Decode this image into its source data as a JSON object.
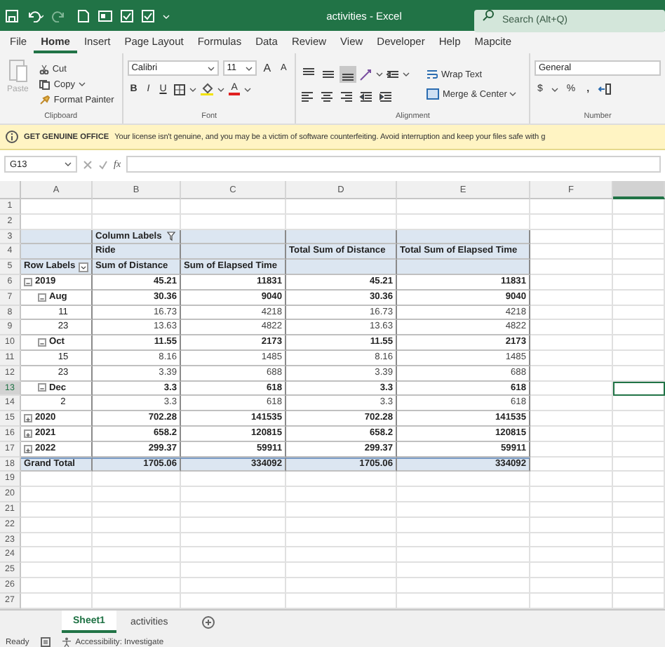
{
  "title_bar": {
    "title": "activities - Excel",
    "search": {
      "placeholder": "Search (Alt+Q)"
    }
  },
  "ribbon_tabs": [
    {
      "label": "File",
      "selected": false
    },
    {
      "label": "Home",
      "selected": true
    },
    {
      "label": "Insert",
      "selected": false
    },
    {
      "label": "Page Layout",
      "selected": false
    },
    {
      "label": "Formulas",
      "selected": false
    },
    {
      "label": "Data",
      "selected": false
    },
    {
      "label": "Review",
      "selected": false
    },
    {
      "label": "View",
      "selected": false
    },
    {
      "label": "Developer",
      "selected": false
    },
    {
      "label": "Help",
      "selected": false
    },
    {
      "label": "Mapcite",
      "selected": false
    }
  ],
  "ribbon": {
    "clipboard": {
      "paste": {
        "label": "Paste",
        "disabled": true
      },
      "cut": "Cut",
      "copy": "Copy",
      "format_painter": "Format Painter",
      "group_label": "Clipboard"
    },
    "font": {
      "family": "Calibri",
      "size": "11",
      "grow": "A",
      "shrink": "A",
      "bold": "B",
      "italic": "I",
      "underline": "U",
      "font_color": "A",
      "group_label": "Font"
    },
    "alignment": {
      "vertical": [
        {
          "selected": false
        },
        {
          "selected": false
        },
        {
          "selected": true
        }
      ],
      "wrap_text": "Wrap Text",
      "merge_center": "Merge & Center",
      "group_label": "Alignment"
    },
    "number": {
      "format": "General",
      "currency": "$",
      "percent": "%",
      "comma": ",",
      "group_label": "Number"
    }
  },
  "notification": {
    "title": "GET GENUINE OFFICE",
    "message": "Your license isn't genuine, and you may be a victim of software counterfeiting. Avoid interruption and keep your files safe with g"
  },
  "formula_bar": {
    "name_box": "G13",
    "function_label": "fx"
  },
  "sheet": {
    "columns": [
      {
        "label": "A",
        "selected": false
      },
      {
        "label": "B",
        "selected": false
      },
      {
        "label": "C",
        "selected": false
      },
      {
        "label": "D",
        "selected": false
      },
      {
        "label": "E",
        "selected": false
      },
      {
        "label": "F",
        "selected": false
      },
      {
        "selected": true
      }
    ],
    "rows": [
      {
        "number": "1",
        "selected": false
      },
      {
        "number": "2",
        "selected": false
      },
      {
        "number": "3",
        "selected": false
      },
      {
        "number": "4",
        "selected": false
      },
      {
        "number": "5",
        "selected": false
      },
      {
        "number": "6",
        "selected": false
      },
      {
        "number": "7",
        "selected": false
      },
      {
        "number": "8",
        "selected": false
      },
      {
        "number": "9",
        "selected": false
      },
      {
        "number": "10",
        "selected": false
      },
      {
        "number": "11",
        "selected": false
      },
      {
        "number": "12",
        "selected": false
      },
      {
        "number": "13",
        "selected": true
      },
      {
        "number": "14",
        "selected": false
      },
      {
        "number": "15",
        "selected": false
      },
      {
        "number": "16",
        "selected": false
      },
      {
        "number": "17",
        "selected": false
      },
      {
        "number": "18",
        "selected": false
      },
      {
        "number": "19",
        "selected": false
      },
      {
        "number": "20",
        "selected": false
      },
      {
        "number": "21",
        "selected": false
      },
      {
        "number": "22",
        "selected": false
      },
      {
        "number": "23",
        "selected": false
      },
      {
        "number": "24",
        "selected": false
      },
      {
        "number": "25",
        "selected": false
      },
      {
        "number": "26",
        "selected": false
      },
      {
        "number": "27",
        "selected": false
      }
    ]
  },
  "pivot": {
    "column_labels": "Column Labels",
    "ride": "Ride",
    "row_labels": "Row Labels",
    "value_headers": [
      "Sum of Distance",
      "Sum of Elapsed Time"
    ],
    "total_headers": [
      "Total Sum of Distance",
      "Total Sum of Elapsed Time"
    ],
    "rows": [
      {
        "kind": "year",
        "expanded": true,
        "label": "2019",
        "values": [
          "45.21",
          "11831",
          "45.21",
          "11831"
        ]
      },
      {
        "kind": "month",
        "expanded": true,
        "label": "Aug",
        "values": [
          "30.36",
          "9040",
          "30.36",
          "9040"
        ]
      },
      {
        "kind": "day",
        "label": "11",
        "values": [
          "16.73",
          "4218",
          "16.73",
          "4218"
        ]
      },
      {
        "kind": "day",
        "label": "23",
        "values": [
          "13.63",
          "4822",
          "13.63",
          "4822"
        ]
      },
      {
        "kind": "month",
        "expanded": true,
        "label": "Oct",
        "values": [
          "11.55",
          "2173",
          "11.55",
          "2173"
        ]
      },
      {
        "kind": "day",
        "label": "15",
        "values": [
          "8.16",
          "1485",
          "8.16",
          "1485"
        ]
      },
      {
        "kind": "day",
        "label": "23",
        "values": [
          "3.39",
          "688",
          "3.39",
          "688"
        ]
      },
      {
        "kind": "month",
        "expanded": true,
        "label": "Dec",
        "values": [
          "3.3",
          "618",
          "3.3",
          "618"
        ]
      },
      {
        "kind": "day",
        "label": "2",
        "values": [
          "3.3",
          "618",
          "3.3",
          "618"
        ]
      },
      {
        "kind": "year",
        "expanded": false,
        "label": "2020",
        "values": [
          "702.28",
          "141535",
          "702.28",
          "141535"
        ]
      },
      {
        "kind": "year",
        "expanded": false,
        "label": "2021",
        "values": [
          "658.2",
          "120815",
          "658.2",
          "120815"
        ]
      },
      {
        "kind": "year",
        "expanded": false,
        "label": "2022",
        "values": [
          "299.37",
          "59911",
          "299.37",
          "59911"
        ]
      }
    ],
    "grand_total": {
      "label": "Grand Total",
      "values": [
        "1705.06",
        "334092",
        "1705.06",
        "334092"
      ]
    }
  },
  "sheet_tabs": [
    {
      "label": "Sheet1",
      "selected": true
    },
    {
      "label": "activities",
      "selected": false
    }
  ],
  "status_bar": {
    "mode": "Ready",
    "accessibility": "Accessibility: Investigate"
  }
}
